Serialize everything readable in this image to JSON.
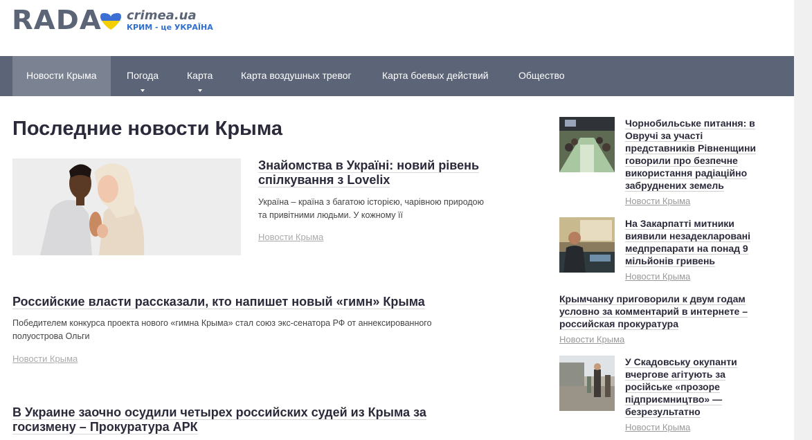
{
  "header": {
    "logo_main": "RADA",
    "logo_site": "crimea.ua",
    "logo_tagline": "КРИМ - це УКРАЇНА"
  },
  "nav": {
    "items": [
      {
        "label": "Новости Крыма",
        "active": true
      },
      {
        "label": "Погода",
        "has_dropdown": true
      },
      {
        "label": "Карта",
        "has_dropdown": true
      },
      {
        "label": "Карта воздушных тревог"
      },
      {
        "label": "Карта боевых действий"
      },
      {
        "label": "Общество"
      }
    ]
  },
  "main": {
    "title": "Последние новости Крыма",
    "articles": [
      {
        "title_line1": "Знайомства в Україні: новий рівень",
        "title_line2": "спілкування з Lovelix",
        "excerpt_line1": "Україна – країна з багатою історією, чарівною природою",
        "excerpt_line2": "та привітними людьми. У кожному її",
        "category": "Новости Крыма"
      },
      {
        "title_line1": "Российские власти рассказали, кто напишет новый «гимн» Крыма",
        "excerpt_line1": "Победителем конкурса проекта нового «гимна Крыма» стал союз экс-сенатора РФ от аннексированного",
        "excerpt_line2": "полуострова Ольги",
        "category": "Новости Крыма"
      },
      {
        "title_line1": "В Украине заочно осудили четырех российских судей из Крыма за",
        "title_line2": "госизмену – Прокуратура АРК"
      }
    ]
  },
  "sidebar": {
    "items": [
      {
        "title_lines": [
          "Чорнобильське питання: в",
          "Овручі за участі",
          "представників Рівненщини",
          "говорили про безпечне",
          "використання радіаційно",
          "забруднених земель"
        ],
        "category": "Новости Крыма"
      },
      {
        "title_lines": [
          "На Закарпатті митники",
          "виявили незадекларовані",
          "медпрепарати на понад 9",
          "мільйонів гривень"
        ],
        "category": "Новости Крыма"
      },
      {
        "title_lines": [
          "Крымчанку приговорили к двум годам",
          "условно за комментарий в интернете –",
          "российская прокуратура"
        ],
        "category": "Новости Крыма"
      },
      {
        "title_lines": [
          "У Скадовську окупанти",
          "вчергове агітують за",
          "російське «прозоре",
          "підприємництво» —",
          "безрезультатно"
        ],
        "category": "Новости Крыма"
      }
    ]
  },
  "colors": {
    "nav_bg": "#5c6577",
    "nav_active": "#7b8292",
    "logo_gray": "#5b6577",
    "tagline_blue": "#2f6fd0",
    "flag_blue": "#3b6fd4",
    "flag_yellow": "#f5d000"
  }
}
